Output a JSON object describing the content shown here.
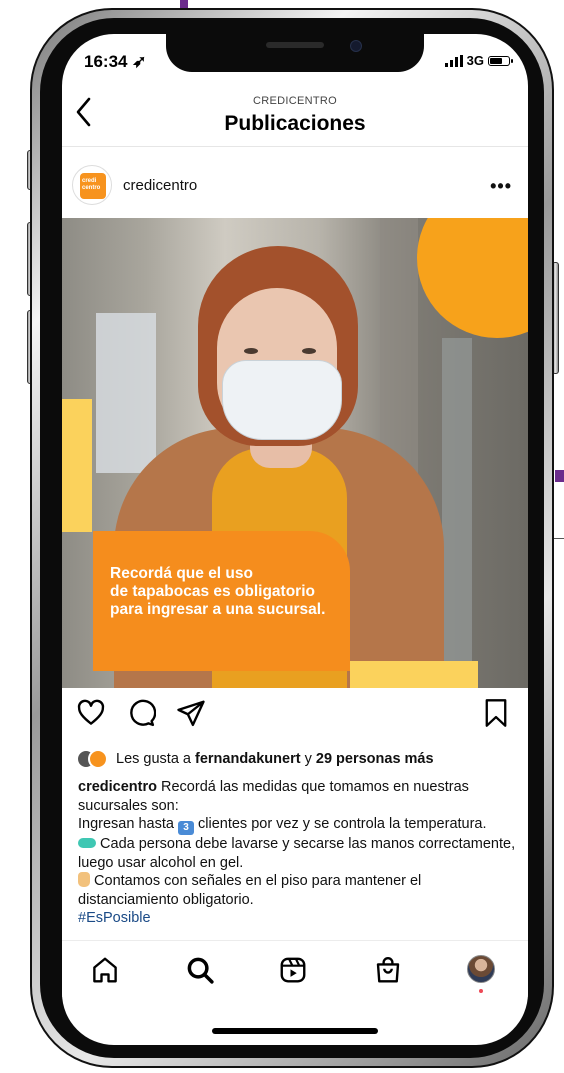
{
  "status_bar": {
    "time": "16:34 ➶",
    "network": "3G",
    "battery_icon": "battery-icon",
    "signal_icon": "signal-bars-icon"
  },
  "header": {
    "account": "CREDICENTRO",
    "title": "Publicaciones",
    "back_icon": "back-chevron-icon"
  },
  "post": {
    "username": "credicentro",
    "more_label": "•••",
    "image_text": [
      "Recordá que el uso",
      "de tapabocas es obligatorio",
      "para ingresar a una sucursal."
    ],
    "actions": {
      "like_icon": "heart-icon",
      "comment_icon": "comment-icon",
      "share_icon": "share-icon",
      "save_icon": "bookmark-icon"
    },
    "likes": {
      "prefix": "Les gusta a ",
      "user": "fernandakunert",
      "middle": " y ",
      "others": "29 personas más"
    },
    "caption": {
      "username": "credicentro",
      "intro": " Recordá las medidas que tomamos en nuestras sucursales son:",
      "line1_a": "Ingresan hasta ",
      "line1_emoji": "3",
      "line1_b": " clientes por vez y se controla la temperatura.",
      "line2": " Cada persona debe lavarse y secarse las manos correctamente, luego usar alcohol en gel.",
      "line3": " Contamos con señales en el piso para mantener el distanciamiento obligatorio.",
      "hashtag": "#EsPosible"
    }
  },
  "bottom_nav": {
    "items": [
      {
        "name": "home",
        "icon": "home-icon"
      },
      {
        "name": "search",
        "icon": "search-icon"
      },
      {
        "name": "reels",
        "icon": "reels-icon"
      },
      {
        "name": "shop",
        "icon": "shop-bag-icon"
      },
      {
        "name": "profile",
        "icon": "profile-avatar"
      }
    ]
  },
  "colors": {
    "brand_orange": "#f58d1d",
    "accent_yellow": "#fbd25c",
    "hashtag_blue": "#1a4a86",
    "notification_red": "#ed4956"
  }
}
